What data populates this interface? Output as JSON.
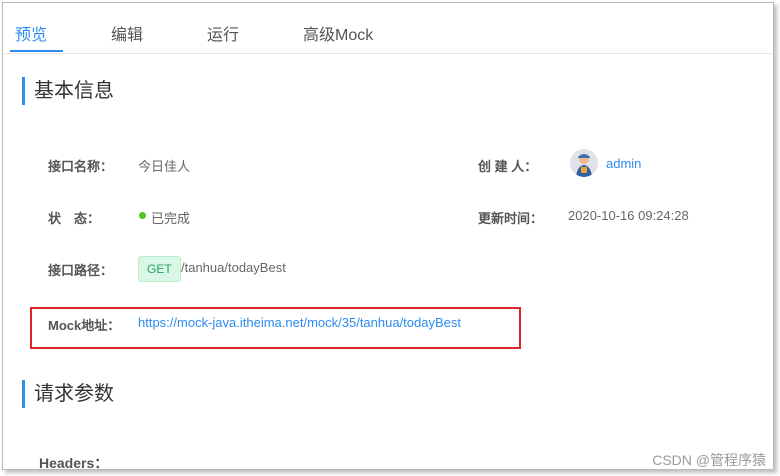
{
  "tabs": [
    {
      "label": "预览",
      "active": true
    },
    {
      "label": "编辑"
    },
    {
      "label": "运行"
    },
    {
      "label": "高级Mock"
    }
  ],
  "sections": {
    "basic_info": "基本信息",
    "request_params": "请求参数"
  },
  "fields": {
    "name_label": "接口名称：",
    "name_value": "今日佳人",
    "creator_label": "创 建 人：",
    "creator_value": "admin",
    "status_label": "状　态：",
    "status_value": "已完成",
    "updated_label": "更新时间：",
    "updated_value": "2020-10-16 09:24:28",
    "path_label": "接口路径：",
    "path_method": "GET",
    "path_value": "/tanhua/todayBest",
    "mock_label": "Mock地址：",
    "mock_value": "https://mock-java.itheima.net/mock/35/tanhua/todayBest"
  },
  "headers_label": "Headers：",
  "watermark": "CSDN @管程序猿",
  "colors": {
    "accent": "#2d8cf0",
    "status_done": "#52c41a",
    "highlight": "#e0242a"
  }
}
